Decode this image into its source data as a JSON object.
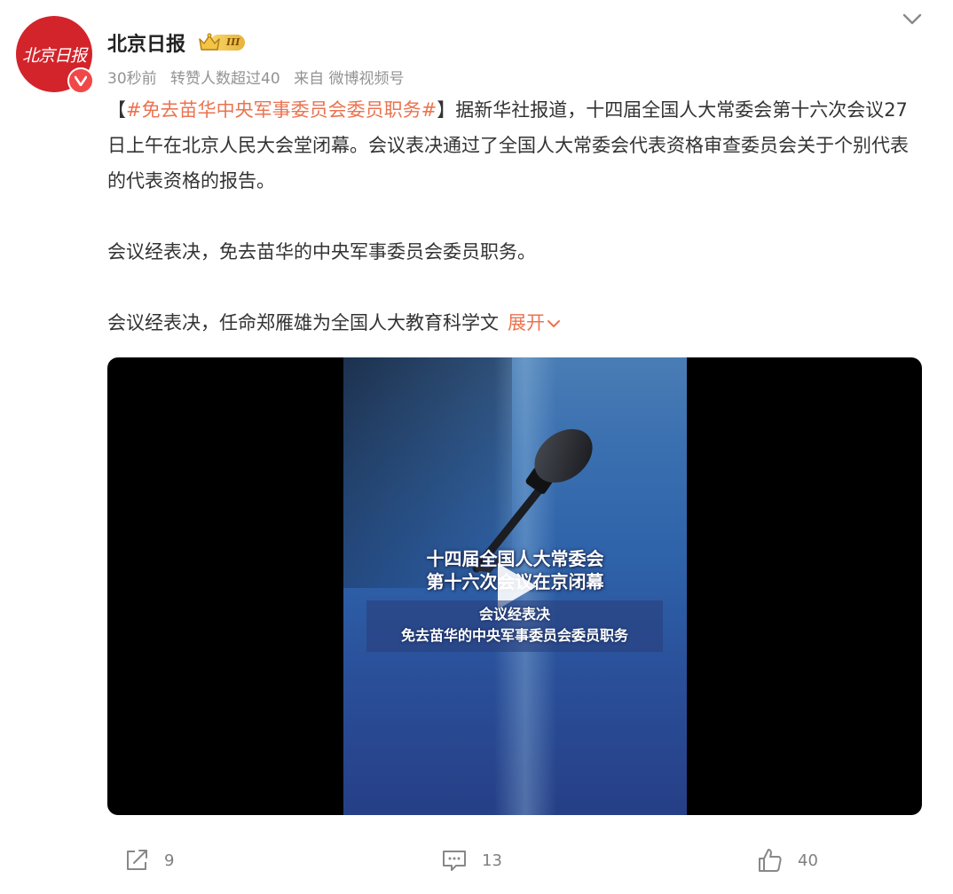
{
  "post": {
    "author": {
      "name": "北京日报",
      "avatar_text": "北京日报",
      "verified_badge_icon": "verified-v-icon",
      "level_badge_text": "III"
    },
    "meta": {
      "time": "30秒前",
      "reposts_note": "转赞人数超过40",
      "source": "来自 微博视频号"
    },
    "body": {
      "bracket_open": "【",
      "hashtag": "#免去苗华中央军事委员会委员职务#",
      "bracket_close": "】",
      "para1": "据新华社报道，十四届全国人大常委会第十六次会议27日上午在北京人民大会堂闭幕。会议表决通过了全国人大常委会代表资格审查委员会关于个别代表的代表资格的报告。",
      "para2": "会议经表决，免去苗华的中央军事委员会委员职务。",
      "para3": "会议经表决，任命郑雁雄为全国人大教育科学文",
      "expand_label": "展开"
    },
    "video": {
      "caption_line1": "十四届全国人大常委会",
      "caption_line2": "第十六次会议在京闭幕",
      "subtitle_line1": "会议经表决",
      "subtitle_line2": "免去苗华的中央军事委员会委员职务"
    },
    "actions": {
      "repost_count": "9",
      "comment_count": "13",
      "like_count": "40"
    }
  },
  "colors": {
    "accent": "#eb7350",
    "avatar_bg": "#d3242b",
    "meta_text": "#939393",
    "body_text": "#333333"
  }
}
